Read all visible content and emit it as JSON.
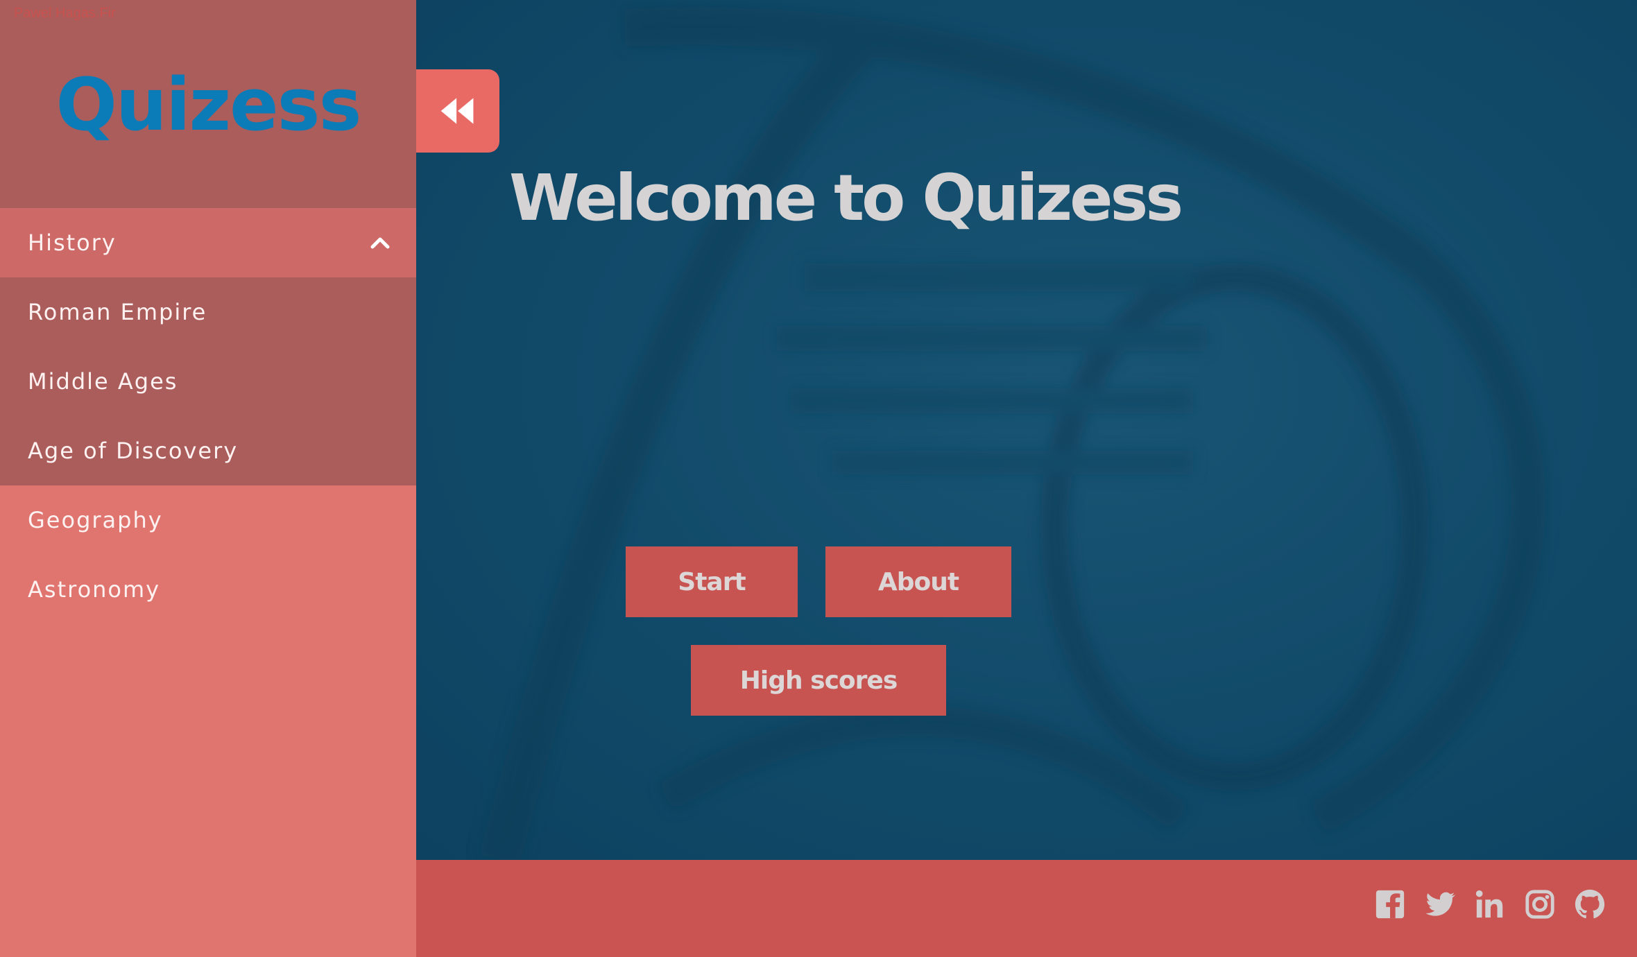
{
  "sidebar": {
    "brand_small": "Pawel Hagas.Fir",
    "logo": "Quizess",
    "items": [
      {
        "label": "History",
        "state": "expanded"
      },
      {
        "label": "Roman Empire"
      },
      {
        "label": "Middle Ages"
      },
      {
        "label": "Age of Discovery"
      },
      {
        "label": "Geography"
      },
      {
        "label": "Astronomy"
      }
    ]
  },
  "main": {
    "collapse_icon": "double-chevron-left-icon",
    "headline": "Welcome to Quizess",
    "buttons": {
      "start": "Start",
      "about": "About",
      "high_scores": "High scores"
    }
  },
  "footer": {
    "socials": [
      "facebook-icon",
      "twitter-icon",
      "linkedin-icon",
      "instagram-icon",
      "github-icon"
    ]
  },
  "colors": {
    "sidebar_bg": "#e07570",
    "sidebar_dark": "#ab5d5b",
    "active_item": "#cd6966",
    "logo": "#0b7cb8",
    "main_bg": "#124b6a",
    "button_bg": "#c85452",
    "footer_bg": "#c95451",
    "collapse_btn": "#e96964",
    "text_light": "#d6d3d5"
  }
}
